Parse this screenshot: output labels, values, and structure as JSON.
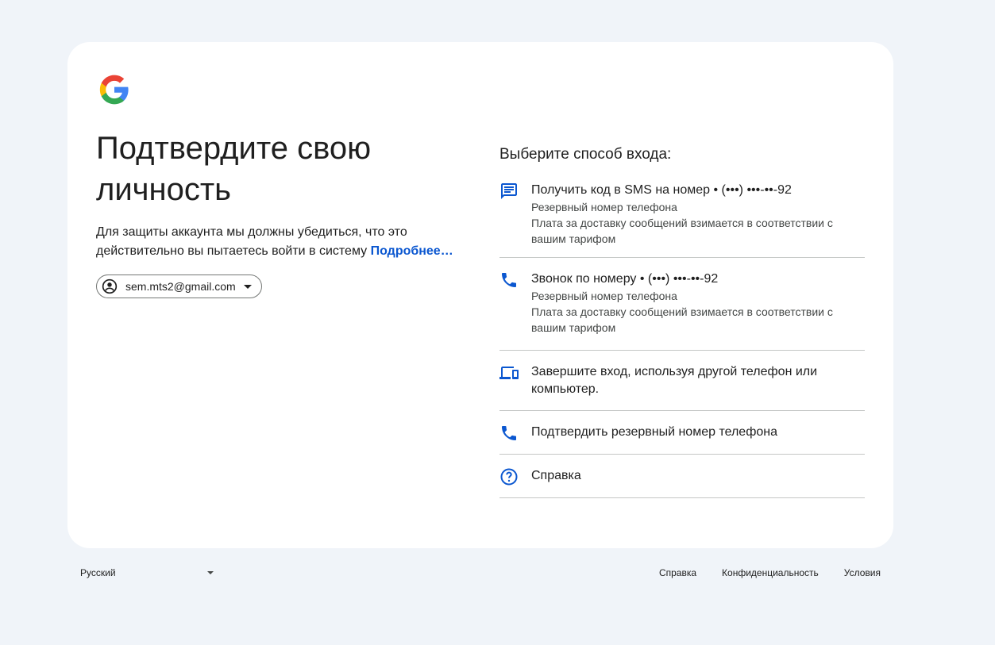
{
  "left": {
    "title": "Подтвердите свою личность",
    "description": "Для защиты аккаунта мы должны убедиться, что это действительно вы пытаетесь войти в систему",
    "learn_more": "Подробнее…",
    "account_email": "sem.mts2@gmail.com"
  },
  "right": {
    "heading": "Выберите способ входа:",
    "options": [
      {
        "icon": "sms-icon",
        "label": "Получить код в SMS на номер • (•••) •••-••-92",
        "sub1": "Резервный номер телефона",
        "sub2": "Плата за доставку сообщений взимается в соответствии с вашим тарифом"
      },
      {
        "icon": "phone-icon",
        "label": "Звонок по номеру • (•••) •••-••-92",
        "sub1": "Резервный номер телефона",
        "sub2": "Плата за доставку сообщений взимается в соответствии с вашим тарифом"
      },
      {
        "icon": "devices-icon",
        "label": "Завершите вход, используя другой телефон или компьютер."
      },
      {
        "icon": "phone-icon",
        "label": "Подтвердить резервный номер телефона"
      },
      {
        "icon": "help-icon",
        "label": "Справка"
      }
    ]
  },
  "footer": {
    "language": "Русский",
    "links": [
      "Справка",
      "Конфиденциальность",
      "Условия"
    ]
  },
  "colors": {
    "background": "#f0f4f9",
    "card": "#ffffff",
    "accent": "#0b57d0",
    "divider": "#c4c7c5"
  }
}
